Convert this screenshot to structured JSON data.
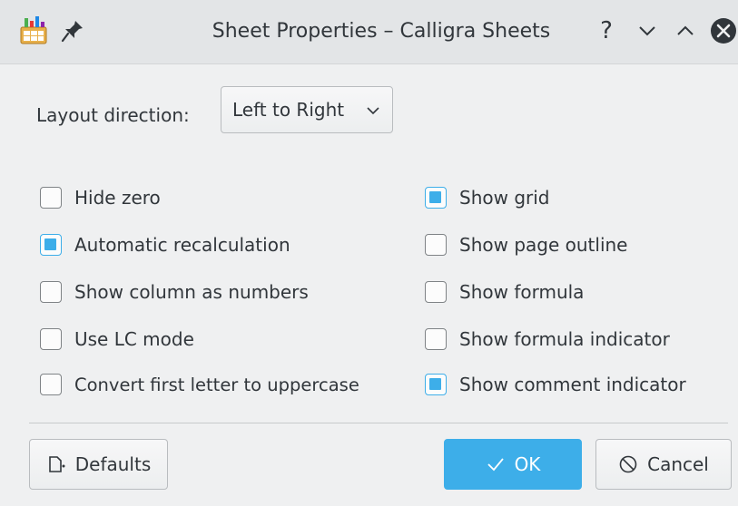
{
  "window": {
    "title": "Sheet Properties – Calligra Sheets",
    "help_glyph": "?"
  },
  "layout": {
    "label": "Layout direction:",
    "selected": "Left to Right"
  },
  "left_options": [
    {
      "label": "Hide zero",
      "checked": false
    },
    {
      "label": "Automatic recalculation",
      "checked": true
    },
    {
      "label": "Show column as numbers",
      "checked": false
    },
    {
      "label": "Use LC mode",
      "checked": false
    },
    {
      "label": "Convert first letter to uppercase",
      "checked": false
    }
  ],
  "right_options": [
    {
      "label": "Show grid",
      "checked": true
    },
    {
      "label": "Show page outline",
      "checked": false
    },
    {
      "label": "Show formula",
      "checked": false
    },
    {
      "label": "Show formula indicator",
      "checked": false
    },
    {
      "label": "Show comment indicator",
      "checked": true
    }
  ],
  "buttons": {
    "defaults": "Defaults",
    "ok": "OK",
    "cancel": "Cancel"
  },
  "colors": {
    "accent": "#3daee9",
    "background": "#eff0f1",
    "text": "#31363b"
  },
  "icons": {
    "app": "calligra-sheets-icon",
    "pin": "pin-icon",
    "defaults": "document-revert-icon",
    "ok": "checkmark-icon",
    "cancel": "cancel-circle-icon"
  }
}
